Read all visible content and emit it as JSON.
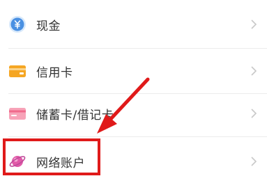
{
  "list": {
    "items": [
      {
        "label": "现金",
        "icon": "yuan-circle-icon",
        "icon_color": "#4a90e2"
      },
      {
        "label": "信用卡",
        "icon": "credit-card-icon",
        "icon_color": "#f5a623"
      },
      {
        "label": "储蓄卡/借记卡",
        "icon": "debit-card-icon",
        "icon_color": "#f06a8b"
      },
      {
        "label": "网络账户",
        "icon": "planet-icon",
        "icon_color": "#e15aa8"
      }
    ]
  },
  "annotation": {
    "highlight_color": "#e01a1a",
    "highlighted_item": "网络账户"
  },
  "colors": {
    "text": "#333333",
    "divider": "#ececec",
    "chevron": "#c8c8c8"
  }
}
